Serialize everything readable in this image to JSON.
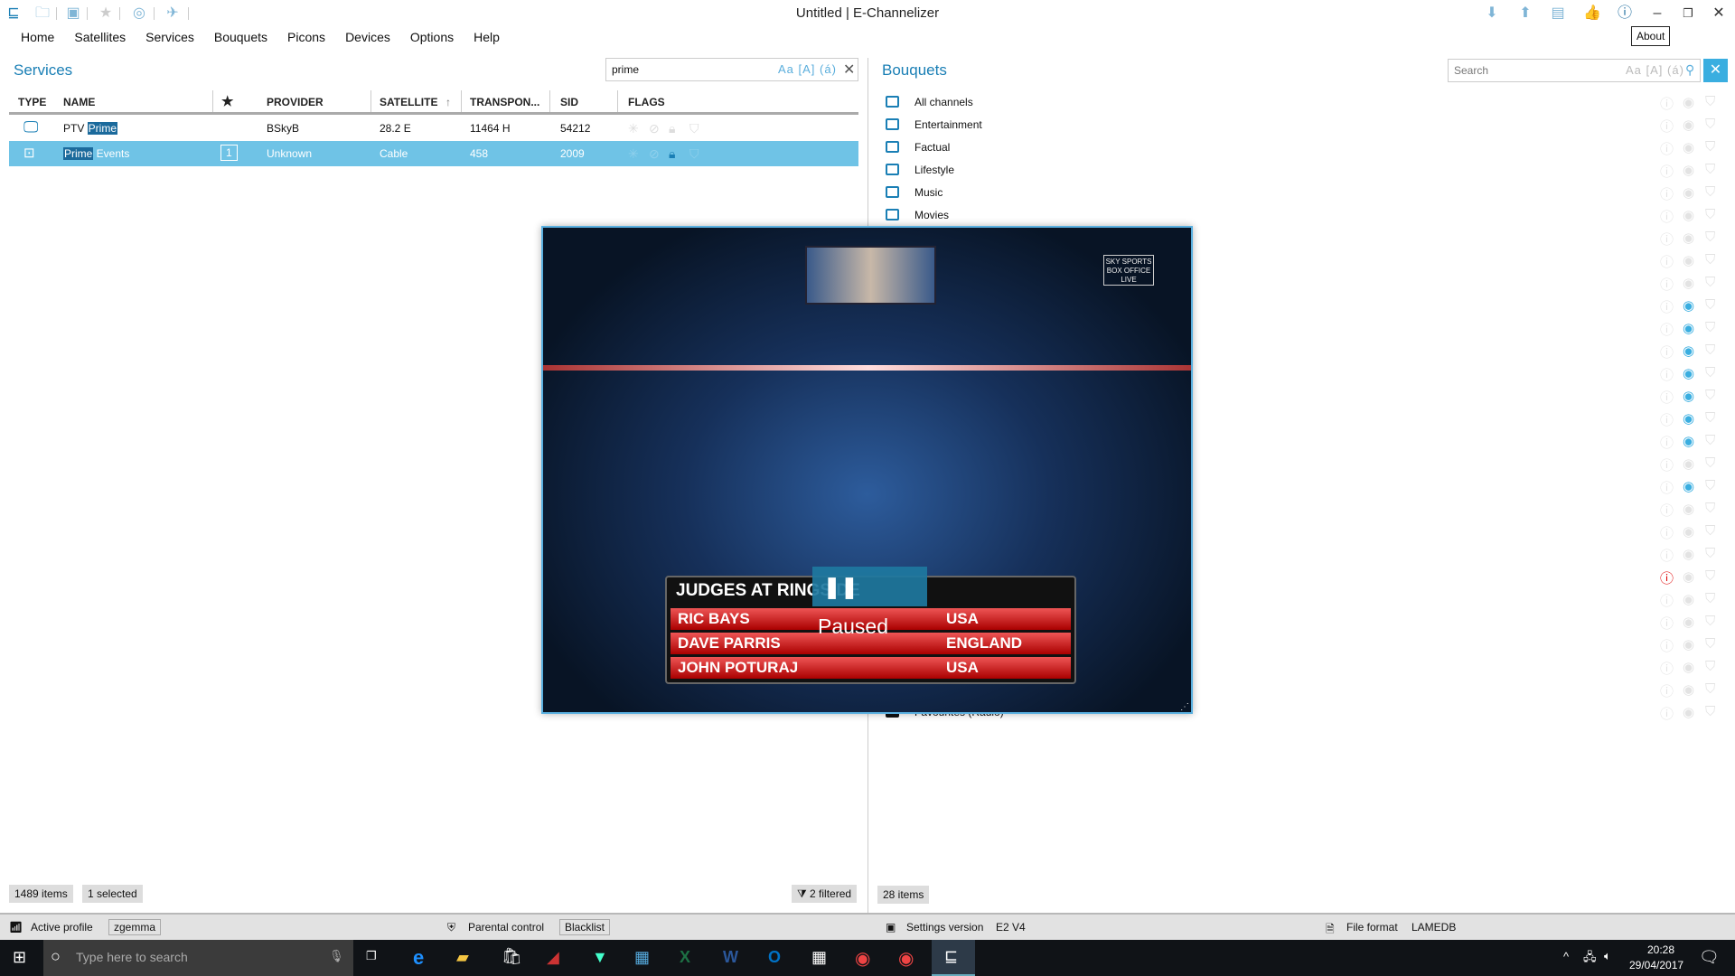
{
  "window": {
    "title": "Untitled | E-Channelizer",
    "tooltip": "About"
  },
  "menu": [
    "Home",
    "Satellites",
    "Services",
    "Bouquets",
    "Picons",
    "Devices",
    "Options",
    "Help"
  ],
  "services": {
    "title": "Services",
    "search_value": "prime",
    "search_opts": "Aa [A] (á)",
    "columns": [
      "TYPE",
      "NAME",
      "★",
      "PROVIDER",
      "SATELLITE",
      "TRANSPON...",
      "SID",
      "FLAGS"
    ],
    "rows": [
      {
        "name_pre": "PTV ",
        "name_hl": "Prime",
        "name_post": "",
        "fav": "",
        "provider": "BSkyB",
        "satellite": "28.2 E",
        "transponder": "11464 H",
        "sid": "54212",
        "selected": false
      },
      {
        "name_pre": "",
        "name_hl": "Prime",
        "name_post": " Events",
        "fav": "1",
        "provider": "Unknown",
        "satellite": "Cable",
        "transponder": "458",
        "sid": "2009",
        "selected": true
      }
    ],
    "count": "1489 items",
    "selected": "1 selected",
    "filtered": "2 filtered"
  },
  "bouquets": {
    "title": "Bouquets",
    "search_placeholder": "Search",
    "search_opts": "Aa [A] (á)",
    "items": [
      "All channels",
      "Entertainment",
      "Factual",
      "Lifestyle",
      "Music",
      "Movies",
      "",
      "",
      "",
      "",
      "",
      "",
      "",
      "",
      "",
      "",
      "",
      "",
      "",
      "",
      "",
      "",
      "",
      "",
      "",
      "",
      "",
      "Favourites (Radio)"
    ],
    "hidden_on_rows": [
      10,
      11,
      12,
      13,
      14,
      15,
      16,
      18
    ],
    "warning_on_rows": [
      22
    ],
    "count": "28 items"
  },
  "player": {
    "status": "Paused",
    "caption_title": "JUDGES AT RINGSIDE",
    "judges": [
      [
        "RIC BAYS",
        "USA"
      ],
      [
        "DAVE PARRIS",
        "ENGLAND"
      ],
      [
        "JOHN POTURAJ",
        "USA"
      ]
    ],
    "logo": "SKY SPORTS BOX OFFICE LIVE"
  },
  "statusbar": {
    "active_profile_label": "Active profile",
    "active_profile": "zgemma",
    "parental_label": "Parental control",
    "parental_value": "Blacklist",
    "settings_label": "Settings version",
    "settings_value": "E2 V4",
    "format_label": "File format",
    "format_value": "LAMEDB"
  },
  "taskbar": {
    "search_placeholder": "Type here to search",
    "time": "20:28",
    "date": "29/04/2017"
  },
  "colors": {
    "accent": "#1a7fb5",
    "selection": "#6fc3e6",
    "hidden": "#3aaee0",
    "warning": "#e00000"
  }
}
